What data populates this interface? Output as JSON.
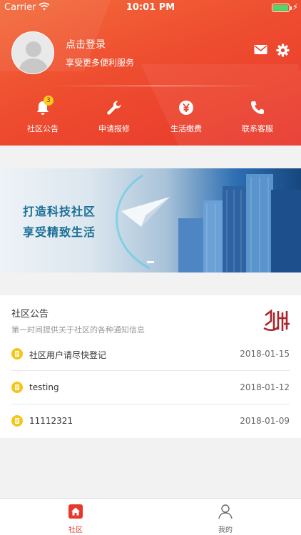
{
  "status_bar": {
    "carrier": "Carrier",
    "time": "10:01 PM"
  },
  "header": {
    "login_title": "点击登录",
    "login_subtitle": "享受更多便利服务",
    "icons": [
      "mail-icon",
      "gear-icon"
    ],
    "quick_actions": [
      {
        "label": "社区公告",
        "icon": "bell-icon",
        "badge": "3"
      },
      {
        "label": "申请报修",
        "icon": "wrench-icon"
      },
      {
        "label": "生活缴费",
        "icon": "yen-icon"
      },
      {
        "label": "联系客服",
        "icon": "phone-icon"
      }
    ]
  },
  "banner": {
    "line1": "打造科技社区",
    "line2": "享受精致生活"
  },
  "notices": {
    "title": "社区公告",
    "subtitle": "第一时间提供关于社区的各种通知信息",
    "items": [
      {
        "text": "社区用户请尽快登记",
        "date": "2018-01-15"
      },
      {
        "text": "testing",
        "date": "2018-01-12"
      },
      {
        "text": "11112321",
        "date": "2018-01-09"
      }
    ]
  },
  "tabbar": {
    "tabs": [
      {
        "label": "社区",
        "icon": "home-icon",
        "active": true
      },
      {
        "label": "我的",
        "icon": "person-icon",
        "active": false
      }
    ]
  },
  "colors": {
    "brand_red": "#e8382d",
    "accent_orange": "#f36b3b",
    "badge_yellow": "#f8d21a",
    "bullet_yellow": "#f5c518",
    "banner_text": "#1b6f97"
  }
}
